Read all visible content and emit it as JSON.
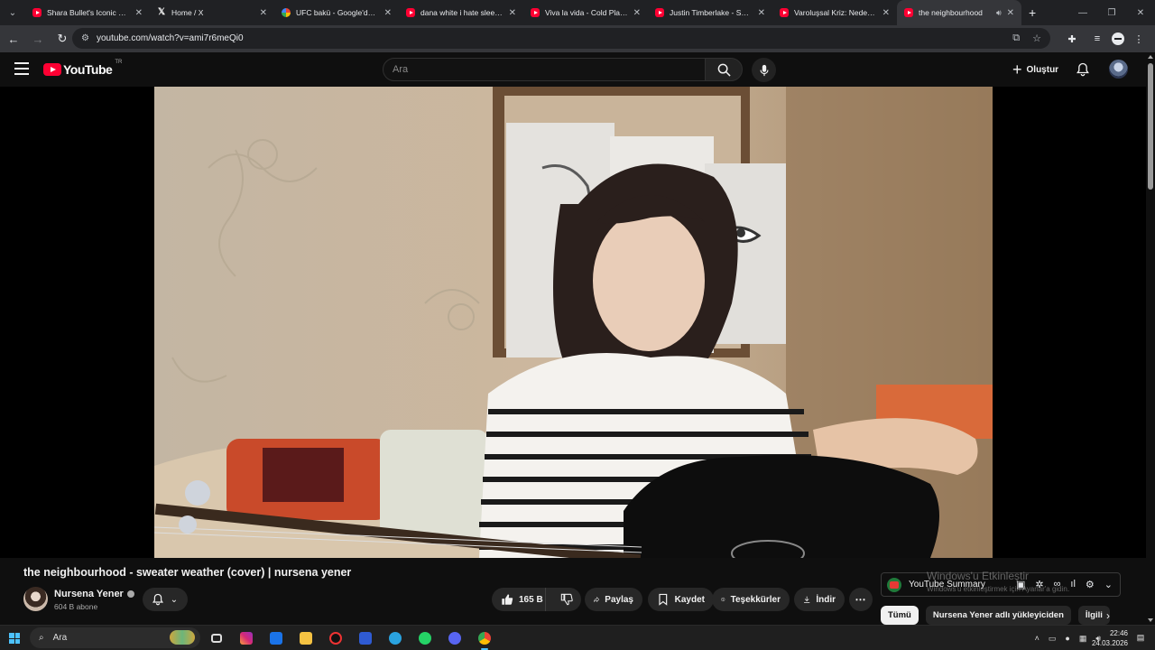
{
  "browser": {
    "tabs": [
      {
        "title": "Shara Bullet's Iconic Com",
        "favicon": "youtube-icon",
        "active": false
      },
      {
        "title": "Home / X",
        "favicon": "x-icon",
        "active": false
      },
      {
        "title": "UFC bakü - Google'da Ara",
        "favicon": "google-icon",
        "active": false
      },
      {
        "title": "dana white i hate sleep -",
        "favicon": "youtube-icon",
        "active": false
      },
      {
        "title": "Viva la vida - Cold Play Al",
        "favicon": "youtube-icon",
        "active": false
      },
      {
        "title": "Justin Timberlake - Sexy",
        "favicon": "youtube-icon",
        "active": false
      },
      {
        "title": "Varoluşsal Kriz: Neden Va",
        "favicon": "youtube-icon",
        "active": false
      },
      {
        "title": "the neighbourhood",
        "favicon": "youtube-icon",
        "active": true
      }
    ],
    "url": "youtube.com/watch?v=ami7r6meQi0"
  },
  "youtube": {
    "logo_text": "YouTube",
    "country_code": "TR",
    "search_placeholder": "Ara",
    "create_label": "Oluştur"
  },
  "video": {
    "title": "the neighbourhood - sweater weather (cover) | nursena yener",
    "channel_name": "Nursena Yener",
    "subscribers": "604 B abone",
    "likes": "165 B",
    "share_label": "Paylaş",
    "save_label": "Kaydet",
    "thanks_label": "Teşekkürler",
    "download_label": "İndir"
  },
  "sidebar": {
    "summary_title": "YouTube Summary",
    "watermark_title": "Windows'u Etkinleştir",
    "watermark_sub": "Windows'u etkinleştirmek için Ayarlar'a gidin.",
    "chips": [
      "Tümü",
      "Nursena Yener adlı yükleyiciden",
      "İlgili"
    ]
  },
  "taskbar": {
    "search_label": "Ara",
    "time": "22:46",
    "date": "24.03.2026"
  },
  "colors": {
    "youtube_red": "#ff0033",
    "background": "#0f0f0f",
    "pill": "#272727",
    "chrome_dark": "#202124"
  }
}
